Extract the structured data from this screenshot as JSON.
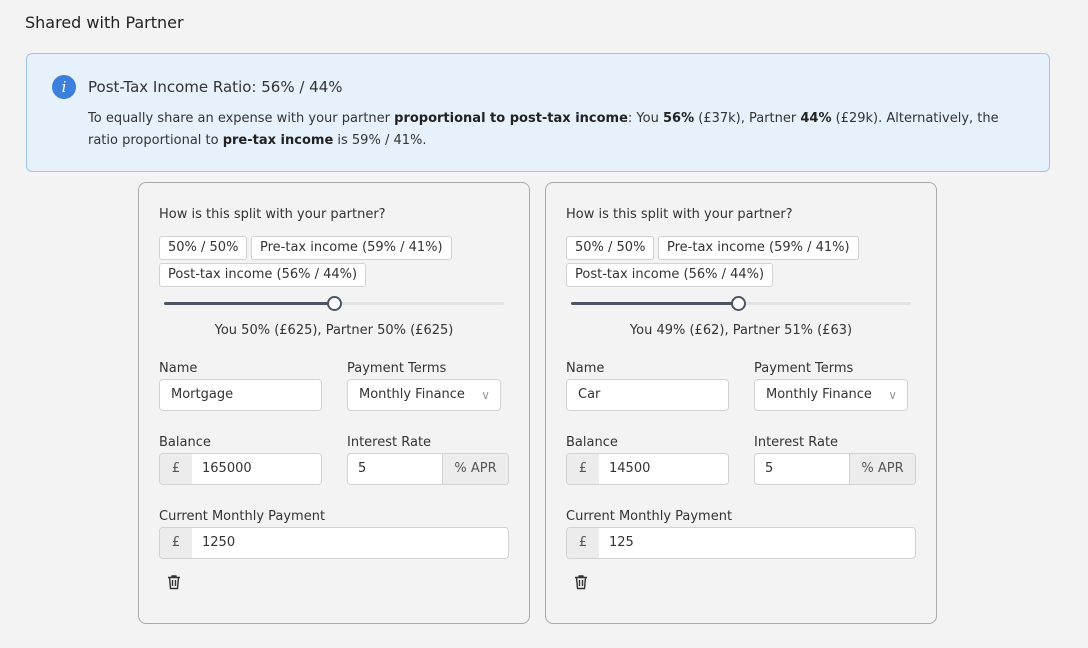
{
  "section": {
    "title": "Shared with Partner"
  },
  "info": {
    "title": "Post-Tax Income Ratio: 56% / 44%",
    "t1": "To equally share an expense with your partner ",
    "b1": "proportional to post-tax income",
    "t2": ": You ",
    "b2": "56%",
    "t3": " (£37k), Partner ",
    "b3": "44%",
    "t4": " (£29k). Alternatively, the ratio proportional to ",
    "b4": "pre-tax income",
    "t5": " is 59% / 41%."
  },
  "cards": [
    {
      "question": "How is this split with your partner?",
      "chips": [
        "50% / 50%",
        "Pre-tax income (59% / 41%)",
        "Post-tax income (56% / 44%)"
      ],
      "slider_you_fraction": 0.5,
      "split_text": "You 50% (£625), Partner 50% (£625)",
      "name_label": "Name",
      "name_value": "Mortgage",
      "terms_label": "Payment Terms",
      "terms_value": "Monthly Finance",
      "balance_label": "Balance",
      "currency": "£",
      "balance_value": "165000",
      "rate_label": "Interest Rate",
      "rate_value": "5",
      "rate_unit": "% APR",
      "payment_label": "Current Monthly Payment",
      "payment_value": "1250"
    },
    {
      "question": "How is this split with your partner?",
      "chips": [
        "50% / 50%",
        "Pre-tax income (59% / 41%)",
        "Post-tax income (56% / 44%)"
      ],
      "slider_you_fraction": 0.49,
      "split_text": "You 49% (£62), Partner 51% (£63)",
      "name_label": "Name",
      "name_value": "Car",
      "terms_label": "Payment Terms",
      "terms_value": "Monthly Finance",
      "balance_label": "Balance",
      "currency": "£",
      "balance_value": "14500",
      "rate_label": "Interest Rate",
      "rate_value": "5",
      "rate_unit": "% APR",
      "payment_label": "Current Monthly Payment",
      "payment_value": "125"
    }
  ],
  "icons": {
    "info": "info-icon",
    "delete": "trash-icon",
    "select": "chevron-down-icon"
  },
  "colors": {
    "accent": "#3d7fdc",
    "info_bg": "#e6f1fb",
    "slider": "#4b5563"
  }
}
